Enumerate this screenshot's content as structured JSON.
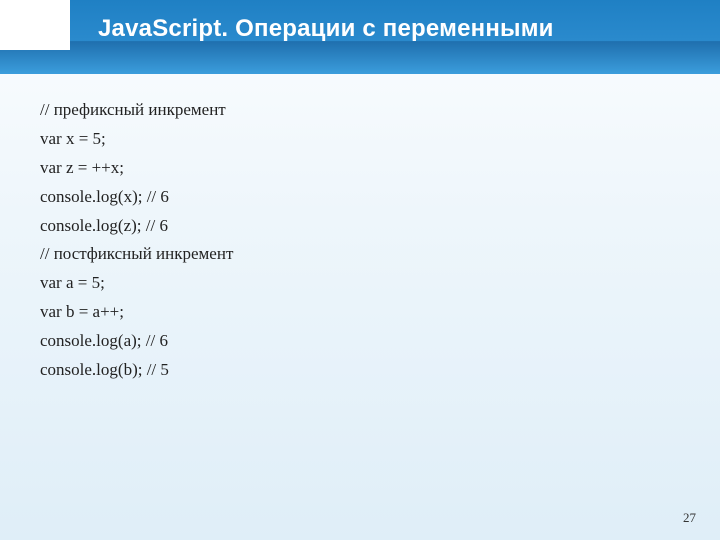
{
  "header": {
    "title": "JavaScript. Операции с переменными"
  },
  "code": {
    "lines": [
      "// префиксный инкремент",
      "var x = 5;",
      "var z = ++x;",
      "console.log(x); // 6",
      "console.log(z); // 6",
      "",
      "// постфиксный инкремент",
      "var a = 5;",
      "var b = a++;",
      "console.log(a); // 6",
      "console.log(b); // 5"
    ]
  },
  "page_number": "27"
}
